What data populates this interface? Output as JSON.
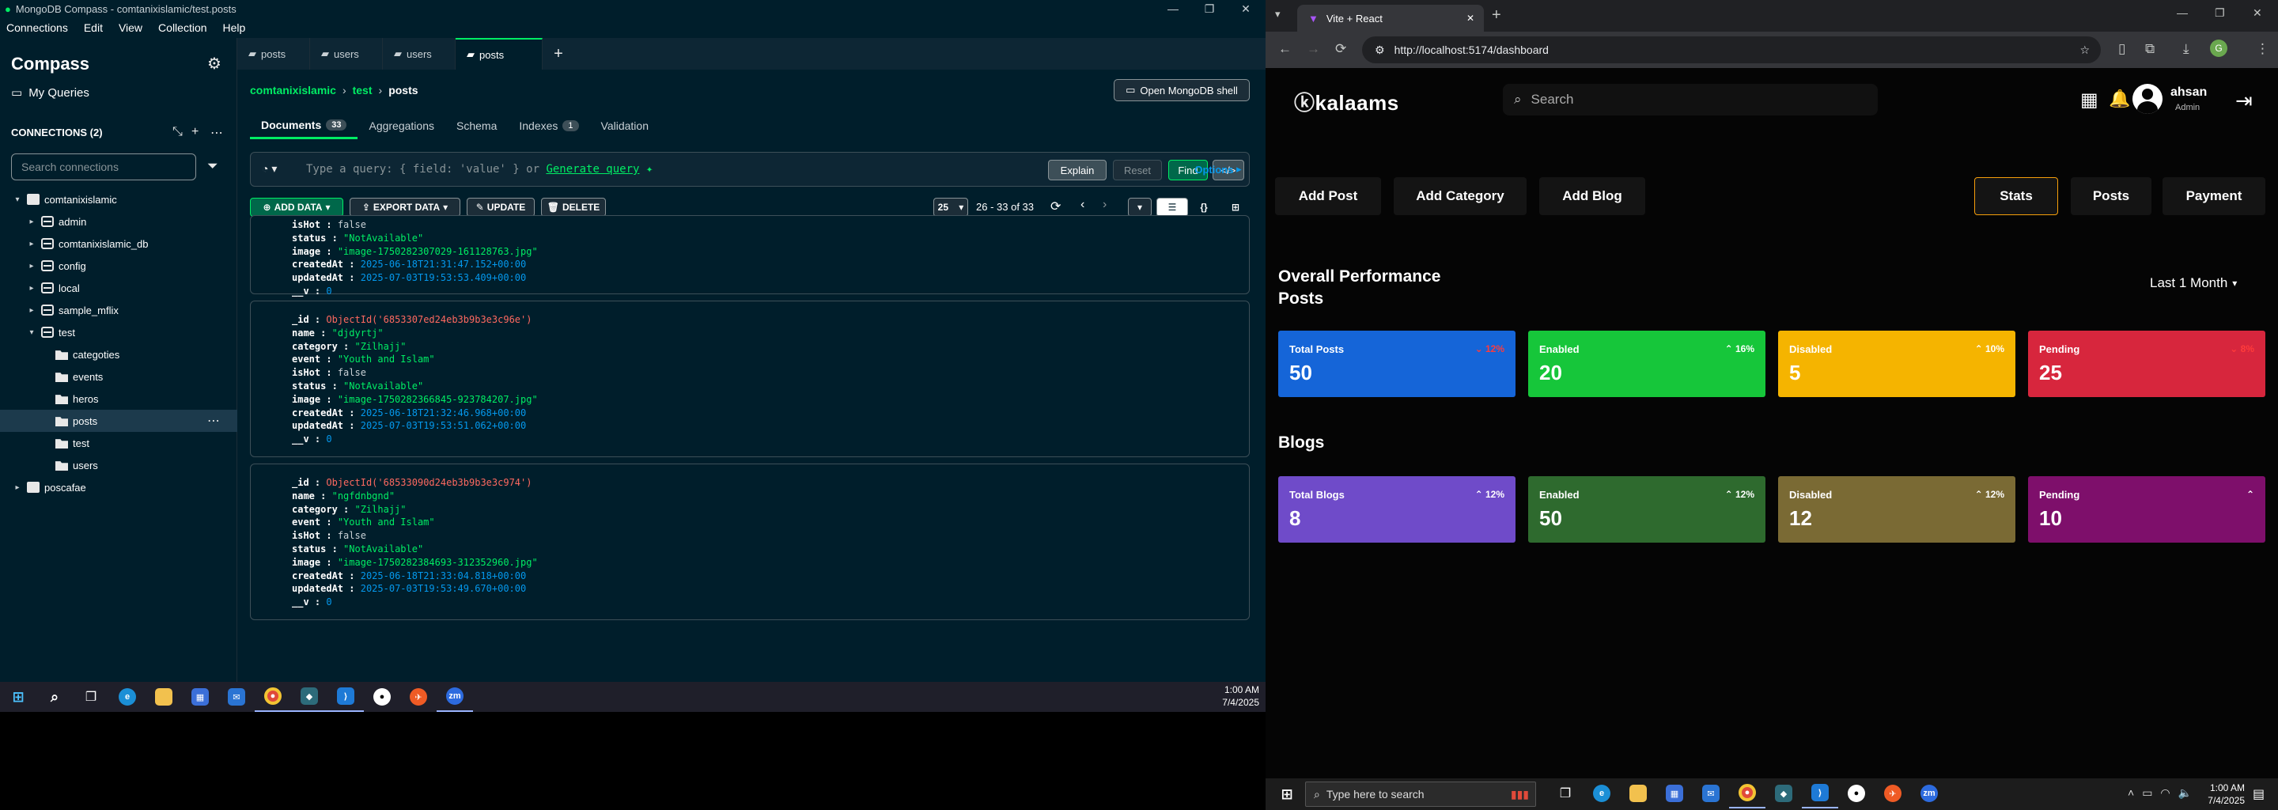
{
  "compass": {
    "window_title": "MongoDB Compass - comtanixislamic/test.posts",
    "menu": [
      "Connections",
      "Edit",
      "View",
      "Collection",
      "Help"
    ],
    "sidebar": {
      "title": "Compass",
      "my_queries": "My Queries",
      "connections_label": "CONNECTIONS (2)",
      "search_placeholder": "Search connections",
      "tree": [
        {
          "label": "comtanixislamic",
          "level": 0,
          "kind": "server",
          "expanded": true
        },
        {
          "label": "admin",
          "level": 1,
          "kind": "db"
        },
        {
          "label": "comtanixislamic_db",
          "level": 1,
          "kind": "db"
        },
        {
          "label": "config",
          "level": 1,
          "kind": "db"
        },
        {
          "label": "local",
          "level": 1,
          "kind": "db"
        },
        {
          "label": "sample_mflix",
          "level": 1,
          "kind": "db"
        },
        {
          "label": "test",
          "level": 1,
          "kind": "db",
          "expanded": true
        },
        {
          "label": "categoties",
          "level": 2,
          "kind": "folder"
        },
        {
          "label": "events",
          "level": 2,
          "kind": "folder"
        },
        {
          "label": "heros",
          "level": 2,
          "kind": "folder"
        },
        {
          "label": "posts",
          "level": 2,
          "kind": "folder",
          "selected": true
        },
        {
          "label": "test",
          "level": 2,
          "kind": "folder"
        },
        {
          "label": "users",
          "level": 2,
          "kind": "folder"
        },
        {
          "label": "poscafae",
          "level": 0,
          "kind": "server"
        }
      ]
    },
    "tabs": [
      {
        "label": "posts"
      },
      {
        "label": "users"
      },
      {
        "label": "users"
      },
      {
        "label": "posts",
        "active": true
      }
    ],
    "breadcrumb": {
      "conn": "comtanixislamic",
      "db": "test",
      "coll": "posts"
    },
    "open_shell": "Open MongoDB shell",
    "subtabs": [
      {
        "label": "Documents",
        "badge": "33",
        "active": true
      },
      {
        "label": "Aggregations"
      },
      {
        "label": "Schema"
      },
      {
        "label": "Indexes",
        "badge": "1"
      },
      {
        "label": "Validation"
      }
    ],
    "query": {
      "placeholder": "Type a query: { field: 'value' } or",
      "generate": "Generate query",
      "explain": "Explain",
      "reset": "Reset",
      "find": "Find",
      "options": "Options"
    },
    "toolbar": {
      "add_data": "ADD DATA",
      "export_data": "EXPORT DATA",
      "update": "UPDATE",
      "delete": "DELETE",
      "page_size": "25",
      "range": "26 - 33 of 33"
    },
    "documents": [
      {
        "fields": [
          {
            "k": "isHot",
            "v": "false",
            "t": "b"
          },
          {
            "k": "status",
            "v": "\"NotAvailable\"",
            "t": "s"
          },
          {
            "k": "image",
            "v": "\"image-1750282307029-161128763.jpg\"",
            "t": "s"
          },
          {
            "k": "createdAt",
            "v": "2025-06-18T21:31:47.152+00:00",
            "t": "d"
          },
          {
            "k": "updatedAt",
            "v": "2025-07-03T19:53:53.409+00:00",
            "t": "d"
          },
          {
            "k": "__v",
            "v": "0",
            "t": "n"
          }
        ]
      },
      {
        "fields": [
          {
            "k": "_id",
            "v": "ObjectId('6853307ed24eb3b9b3e3c96e')",
            "t": "o"
          },
          {
            "k": "name",
            "v": "\"djdyrtj\"",
            "t": "s"
          },
          {
            "k": "category",
            "v": "\"Zilhajj\"",
            "t": "s"
          },
          {
            "k": "event",
            "v": "\"Youth and Islam\"",
            "t": "s"
          },
          {
            "k": "isHot",
            "v": "false",
            "t": "b"
          },
          {
            "k": "status",
            "v": "\"NotAvailable\"",
            "t": "s"
          },
          {
            "k": "image",
            "v": "\"image-1750282366845-923784207.jpg\"",
            "t": "s"
          },
          {
            "k": "createdAt",
            "v": "2025-06-18T21:32:46.968+00:00",
            "t": "d"
          },
          {
            "k": "updatedAt",
            "v": "2025-07-03T19:53:51.062+00:00",
            "t": "d"
          },
          {
            "k": "__v",
            "v": "0",
            "t": "n"
          }
        ]
      },
      {
        "fields": [
          {
            "k": "_id",
            "v": "ObjectId('68533090d24eb3b9b3e3c974')",
            "t": "o"
          },
          {
            "k": "name",
            "v": "\"ngfdnbgnd\"",
            "t": "s"
          },
          {
            "k": "category",
            "v": "\"Zilhajj\"",
            "t": "s"
          },
          {
            "k": "event",
            "v": "\"Youth and Islam\"",
            "t": "s"
          },
          {
            "k": "isHot",
            "v": "false",
            "t": "b"
          },
          {
            "k": "status",
            "v": "\"NotAvailable\"",
            "t": "s"
          },
          {
            "k": "image",
            "v": "\"image-1750282384693-312352960.jpg\"",
            "t": "s"
          },
          {
            "k": "createdAt",
            "v": "2025-06-18T21:33:04.818+00:00",
            "t": "d"
          },
          {
            "k": "updatedAt",
            "v": "2025-07-03T19:53:49.670+00:00",
            "t": "d"
          },
          {
            "k": "__v",
            "v": "0",
            "t": "n"
          }
        ]
      }
    ],
    "clock": {
      "time": "1:00 AM",
      "date": "7/4/2025"
    }
  },
  "browser": {
    "tab_title": "Vite + React",
    "url": "http://localhost:5174/dashboard",
    "app": {
      "logo": "kalaams",
      "search_placeholder": "Search",
      "user_name": "ahsan",
      "user_role": "Admin",
      "nav_left": [
        "Add Post",
        "Add Category",
        "Add Blog"
      ],
      "nav_right": [
        {
          "label": "Stats",
          "active": true
        },
        {
          "label": "Posts"
        },
        {
          "label": "Payment"
        }
      ],
      "overall_title": "Overall Performance",
      "posts_title": "Posts",
      "range_select": "Last 1 Month",
      "blogs_title": "Blogs",
      "posts_cards": [
        {
          "label": "Total Posts",
          "value": "50",
          "pct": "12%",
          "dir": "down",
          "color": "#1565d8"
        },
        {
          "label": "Enabled",
          "value": "20",
          "pct": "16%",
          "dir": "up",
          "color": "#16c63a"
        },
        {
          "label": "Disabled",
          "value": "5",
          "pct": "10%",
          "dir": "up",
          "color": "#f5b400"
        },
        {
          "label": "Pending",
          "value": "25",
          "pct": "8%",
          "dir": "down",
          "color": "#d7263d"
        }
      ],
      "blogs_cards": [
        {
          "label": "Total Blogs",
          "value": "8",
          "pct": "12%",
          "dir": "up",
          "color": "#6f4bc9"
        },
        {
          "label": "Enabled",
          "value": "50",
          "pct": "12%",
          "dir": "up",
          "color": "#2e6a2e"
        },
        {
          "label": "Disabled",
          "value": "12",
          "pct": "12%",
          "dir": "up",
          "color": "#7a6a34"
        },
        {
          "label": "Pending",
          "value": "10",
          "pct": "",
          "dir": "up",
          "color": "#7e0f6b"
        }
      ]
    }
  },
  "taskbar": {
    "search_placeholder": "Type here to search",
    "time": "1:00 AM",
    "date": "7/4/2025"
  }
}
